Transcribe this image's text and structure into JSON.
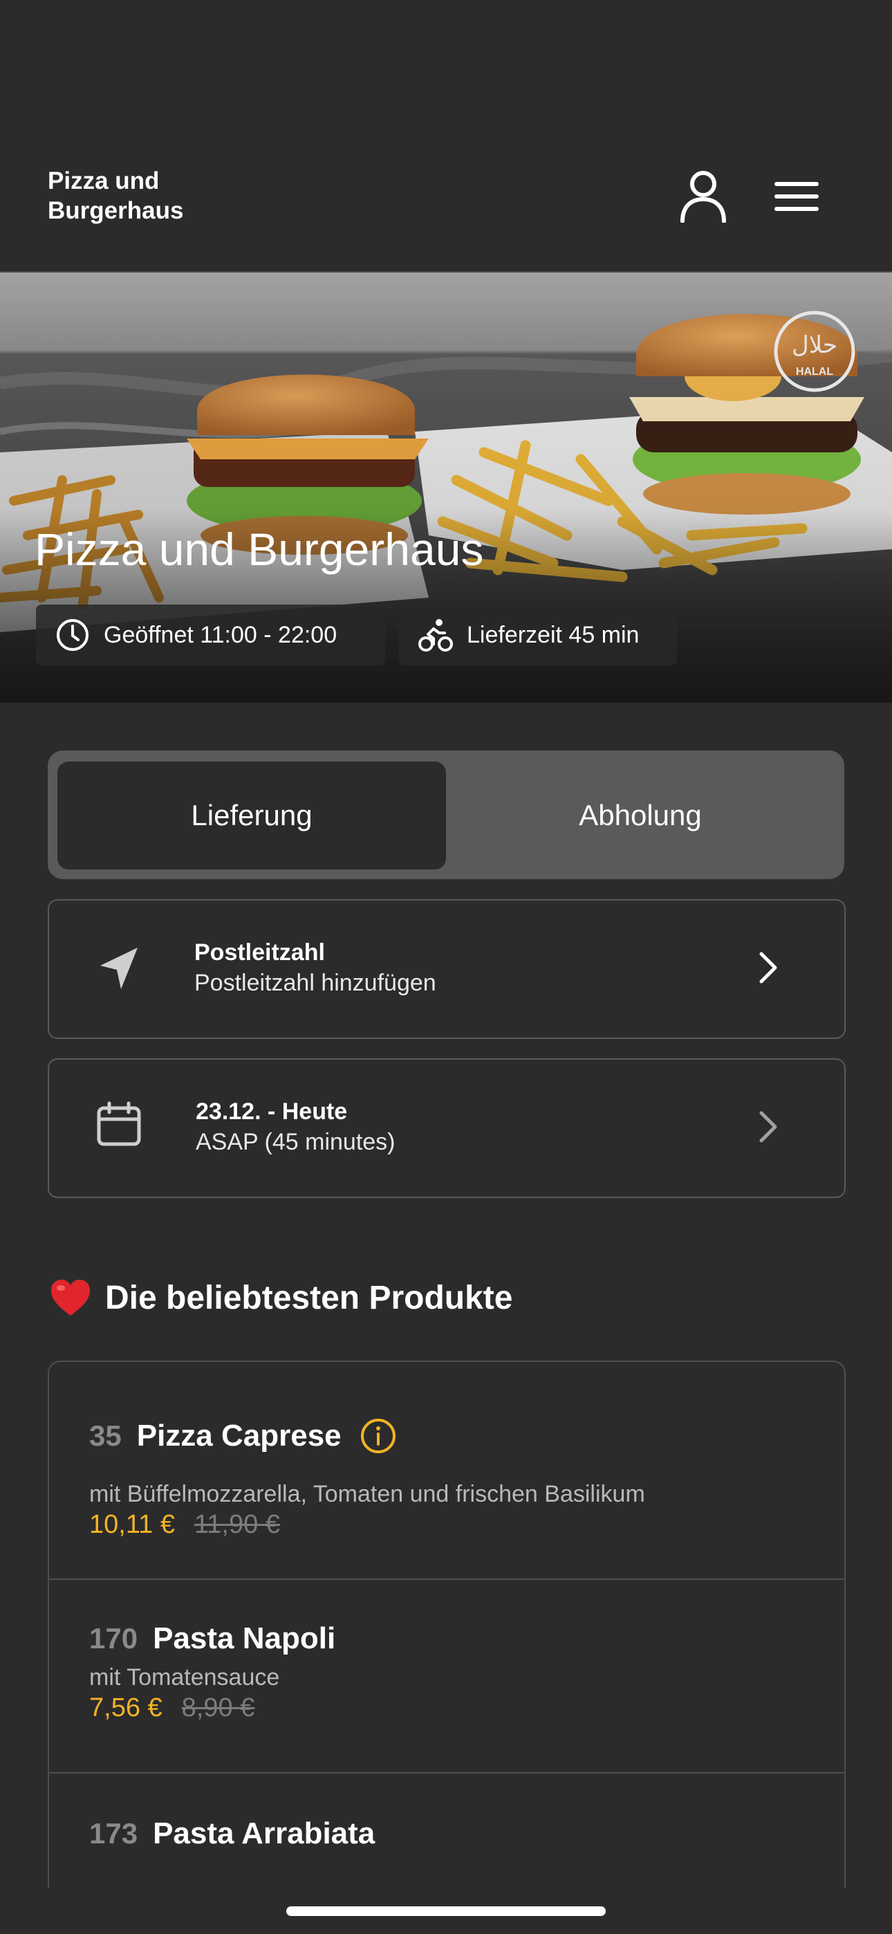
{
  "header": {
    "brand_line1": "Pizza und",
    "brand_line2": "Burgerhaus",
    "user_icon": "user-icon",
    "menu_icon": "hamburger-menu-icon"
  },
  "hero": {
    "title": "Pizza und Burgerhaus",
    "opening_hours": "Geöffnet 11:00 - 22:00",
    "delivery_time": "Lieferzeit 45 min",
    "badge": "HALAL",
    "badge_script": "حلال"
  },
  "order_mode": {
    "options": [
      "Lieferung",
      "Abholung"
    ],
    "selected": "Lieferung"
  },
  "postcode_row": {
    "title": "Postleitzahl",
    "subtitle": "Postleitzahl hinzufügen",
    "icon": "location-arrow-icon"
  },
  "date_row": {
    "title": "23.12. - Heute",
    "subtitle": "ASAP (45 minutes)",
    "icon": "calendar-icon"
  },
  "popular": {
    "title": "Die beliebtesten Produkte",
    "items": [
      {
        "number": "35",
        "name": "Pizza Caprese",
        "description": "mit Büffelmozzarella, Tomaten und frischen Basilikum",
        "price": "10,11 €",
        "old_price": "11,90 €",
        "has_info": true
      },
      {
        "number": "170",
        "name": "Pasta Napoli",
        "description": "mit Tomatensauce",
        "price": "7,56 €",
        "old_price": "8,90 €",
        "has_info": false
      },
      {
        "number": "173",
        "name": "Pasta Arrabiata",
        "description": "",
        "price": "",
        "old_price": "",
        "has_info": false
      }
    ]
  },
  "colors": {
    "background": "#2b2b2c",
    "accent": "#f5b324",
    "toggle_bg": "#5a5a5a"
  }
}
